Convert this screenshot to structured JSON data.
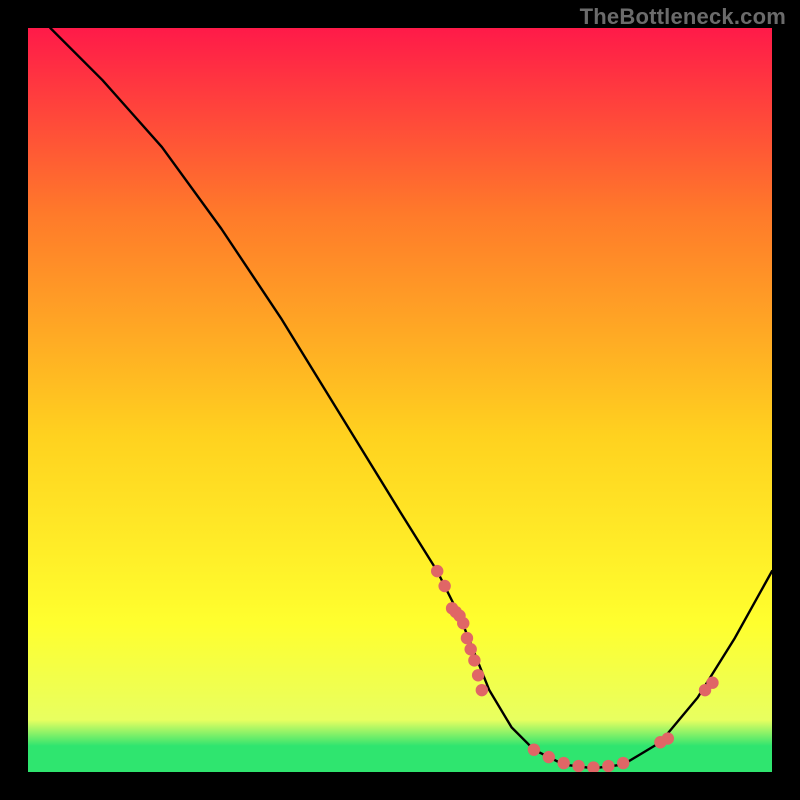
{
  "watermark": "TheBottleneck.com",
  "chart_data": {
    "type": "line",
    "title": "",
    "xlabel": "",
    "ylabel": "",
    "xlim": [
      0,
      100
    ],
    "ylim": [
      0,
      100
    ],
    "grid": false,
    "legend": false,
    "background_gradient": {
      "top": "#ff1a49",
      "mid_upper": "#ff7a2a",
      "mid": "#ffd21f",
      "mid_lower": "#ffff2e",
      "near_bottom": "#e8ff60",
      "bottom_band": "#2fe56f"
    },
    "series": [
      {
        "name": "curve",
        "stroke": "#000000",
        "x": [
          3,
          10,
          18,
          26,
          34,
          42,
          50,
          55,
          58,
          60,
          62,
          65,
          68,
          72,
          76,
          80,
          85,
          90,
          95,
          100
        ],
        "y": [
          100,
          93,
          84,
          73,
          61,
          48,
          35,
          27,
          21,
          16,
          11,
          6,
          3,
          1,
          0.5,
          1,
          4,
          10,
          18,
          27
        ]
      }
    ],
    "points": {
      "name": "dots",
      "fill": "#e06666",
      "x": [
        55,
        56,
        57,
        57.5,
        58,
        58.5,
        59,
        59.5,
        60,
        60.5,
        61,
        68,
        70,
        72,
        74,
        76,
        78,
        80,
        85,
        86,
        91,
        92
      ],
      "y": [
        27,
        25,
        22,
        21.5,
        21,
        20,
        18,
        16.5,
        15,
        13,
        11,
        3,
        2,
        1.2,
        0.8,
        0.6,
        0.8,
        1.2,
        4,
        4.5,
        11,
        12
      ]
    }
  }
}
